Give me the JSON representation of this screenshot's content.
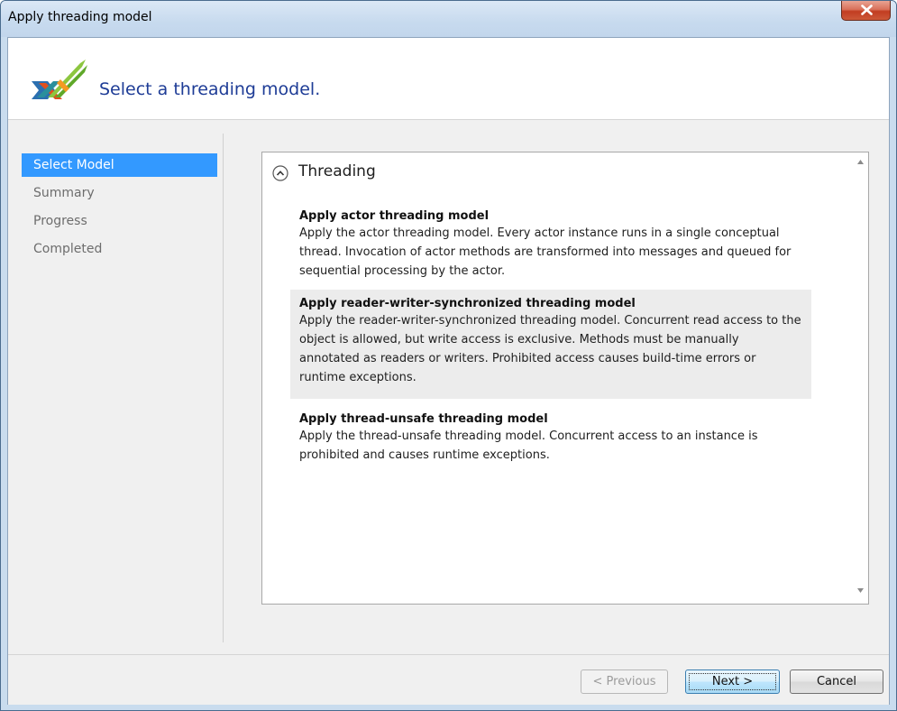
{
  "window": {
    "title": "Apply threading model"
  },
  "header": {
    "title": "Select a threading model.",
    "logo_icon": "crossed-arrows-logo-icon"
  },
  "nav": {
    "items": [
      {
        "label": "Select Model",
        "selected": true
      },
      {
        "label": "Summary",
        "selected": false
      },
      {
        "label": "Progress",
        "selected": false
      },
      {
        "label": "Completed",
        "selected": false
      }
    ]
  },
  "panel": {
    "section_title": "Threading",
    "options": [
      {
        "title": "Apply actor threading model",
        "description": "Apply the actor threading model. Every actor instance runs in a single conceptual thread. Invocation of actor methods are transformed into messages and queued for sequential processing by the actor."
      },
      {
        "title": "Apply reader-writer-synchronized threading model",
        "description": "Apply the reader-writer-synchronized threading model. Concurrent read access to the object is allowed, but write access is exclusive. Methods must be manually annotated as readers or writers. Prohibited access causes build-time errors or runtime exceptions."
      },
      {
        "title": "Apply thread-unsafe threading model",
        "description": "Apply the thread-unsafe threading model. Concurrent access to an instance is prohibited and causes runtime exceptions."
      }
    ]
  },
  "footer": {
    "previous_label": "< Previous",
    "next_label": "Next >",
    "cancel_label": "Cancel"
  },
  "colors": {
    "accent": "#3399ff",
    "header_title": "#1e3c96",
    "hover_row": "#ececec"
  }
}
